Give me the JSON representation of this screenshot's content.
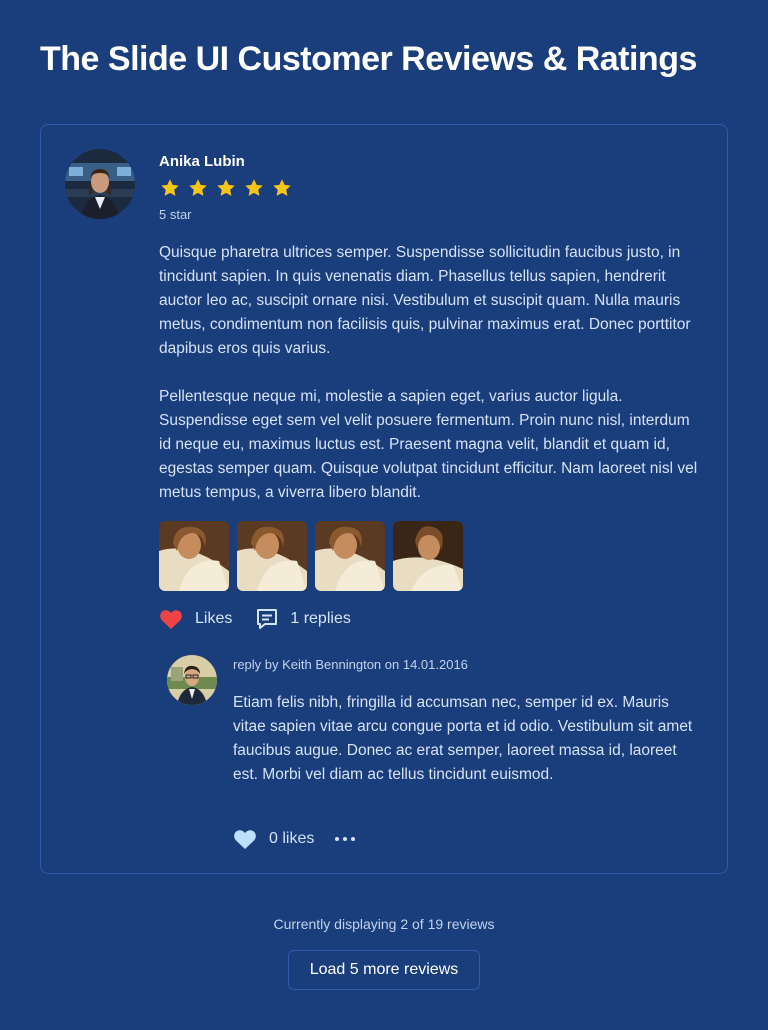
{
  "page": {
    "title": "The Slide UI Customer Reviews & Ratings"
  },
  "colors": {
    "background": "#1a3d7c",
    "border": "#2f5aa8",
    "star": "#f5c518",
    "heart_liked": "#ef4444",
    "heart_reply": "#bde0ff"
  },
  "review": {
    "author": "Anika Lubin",
    "rating": 5,
    "rating_label": "5 star",
    "paragraphs": [
      "Quisque pharetra ultrices semper. Suspendisse sollicitudin faucibus justo, in tincidunt sapien. In quis venenatis diam. Phasellus tellus sapien, hendrerit auctor leo ac, suscipit ornare nisi. Vestibulum et suscipit quam. Nulla mauris metus, condimentum non facilisis quis, pulvinar maximus erat. Donec porttitor dapibus eros quis varius.",
      "Pellentesque neque mi, molestie a sapien eget, varius auctor ligula. Suspendisse eget sem vel velit posuere fermentum. Proin nunc nisl, interdum id neque eu, maximus luctus est. Praesent magna velit, blandit et quam id, egestas semper quam. Quisque volutpat tincidunt efficitur. Nam laoreet nisl vel metus tempus, a viverra libero blandit."
    ],
    "likes_label": "Likes",
    "replies_label": "1 replies",
    "icons": {
      "like": "heart-icon",
      "replies": "comment-icon"
    }
  },
  "reply": {
    "meta": "reply by Keith Bennington on 14.01.2016",
    "body": "Etiam felis nibh, fringilla id accumsan nec, semper id ex. Mauris vitae sapien vitae arcu congue porta et id odio. Vestibulum sit amet faucibus augue. Donec ac erat semper, laoreet massa id, laoreet est. Morbi vel diam ac tellus tincidunt euismod.",
    "likes_label": "0 likes",
    "icons": {
      "like": "heart-icon",
      "more": "more-dots-icon"
    }
  },
  "footer": {
    "count_text": "Currently displaying 2 of 19 reviews",
    "load_button": "Load 5 more reviews"
  }
}
